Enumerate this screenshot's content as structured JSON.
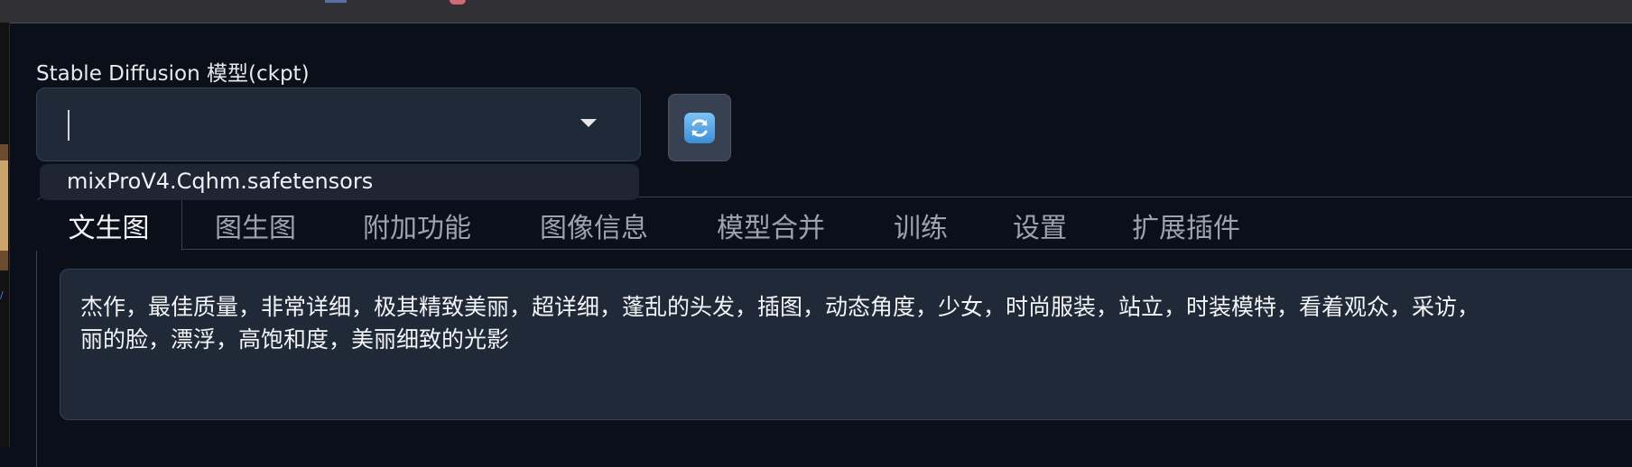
{
  "model": {
    "label": "Stable Diffusion 模型(ckpt)",
    "selected_value": "",
    "dropdown_options": [
      "mixProV4.Cqhm.safetensors"
    ]
  },
  "refresh_button": {
    "icon": "refresh-icon"
  },
  "tabs": [
    {
      "label": "文生图",
      "active": true
    },
    {
      "label": "图生图",
      "active": false
    },
    {
      "label": "附加功能",
      "active": false
    },
    {
      "label": "图像信息",
      "active": false
    },
    {
      "label": "模型合并",
      "active": false
    },
    {
      "label": "训练",
      "active": false
    },
    {
      "label": "设置",
      "active": false
    },
    {
      "label": "扩展插件",
      "active": false
    }
  ],
  "prompt": {
    "line1": "杰作，最佳质量，非常详细，极其精致美丽，超详细，蓬乱的头发，插图，动态角度，少女，时尚服装，站立，时装模特，看着观众，采访，",
    "line2": "丽的脸，漂浮，高饱和度，美丽细致的光影"
  },
  "colors": {
    "background": "#0b0f19",
    "input_bg": "#1f2937",
    "border": "#374151",
    "tab_inactive": "#9ca3af",
    "tab_active": "#f3f4f6"
  }
}
